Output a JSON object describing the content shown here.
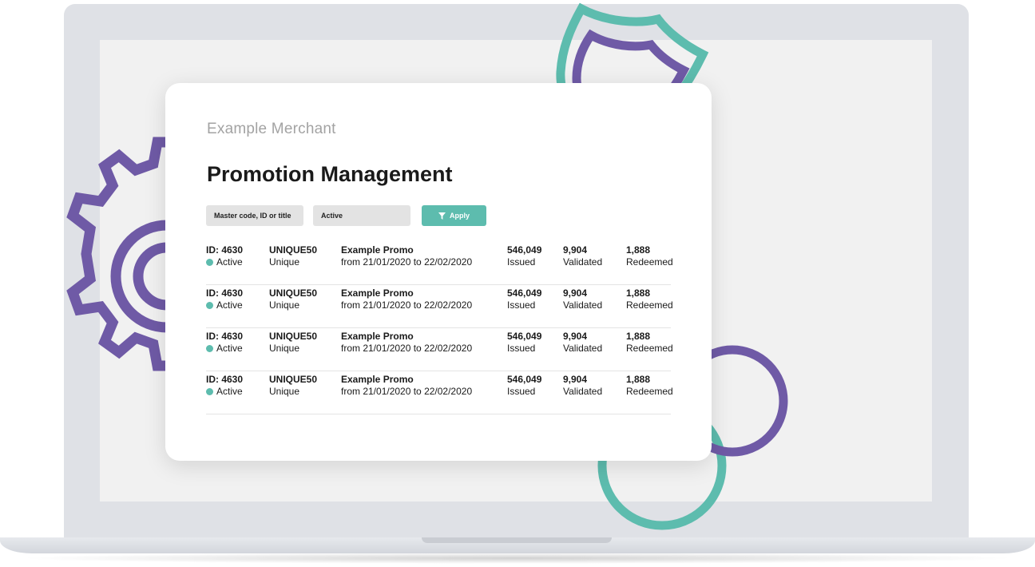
{
  "colors": {
    "accent_teal": "#5dbcae",
    "accent_purple": "#6f5aa6",
    "laptop_frame": "#dfe1e6",
    "screen_bg": "#f1f1f1"
  },
  "header": {
    "merchant": "Example Merchant",
    "title": "Promotion Management"
  },
  "filters": {
    "search_value": "Master code, ID or title",
    "status_value": "Active",
    "apply_label": "Apply",
    "apply_icon": "filter-icon"
  },
  "promotions": [
    {
      "id": "ID: 4630",
      "status": "Active",
      "code": "UNIQUE50",
      "code_type": "Unique",
      "title": "Example Promo",
      "dates": "from 21/01/2020 to 22/02/2020",
      "issued": "546,049",
      "issued_label": "Issued",
      "validated": "9,904",
      "validated_label": "Validated",
      "redeemed": "1,888",
      "redeemed_label": "Redeemed"
    },
    {
      "id": "ID: 4630",
      "status": "Active",
      "code": "UNIQUE50",
      "code_type": "Unique",
      "title": "Example Promo",
      "dates": "from 21/01/2020 to 22/02/2020",
      "issued": "546,049",
      "issued_label": "Issued",
      "validated": "9,904",
      "validated_label": "Validated",
      "redeemed": "1,888",
      "redeemed_label": "Redeemed"
    },
    {
      "id": "ID: 4630",
      "status": "Active",
      "code": "UNIQUE50",
      "code_type": "Unique",
      "title": "Example Promo",
      "dates": "from 21/01/2020 to 22/02/2020",
      "issued": "546,049",
      "issued_label": "Issued",
      "validated": "9,904",
      "validated_label": "Validated",
      "redeemed": "1,888",
      "redeemed_label": "Redeemed"
    },
    {
      "id": "ID: 4630",
      "status": "Active",
      "code": "UNIQUE50",
      "code_type": "Unique",
      "title": "Example Promo",
      "dates": "from 21/01/2020 to 22/02/2020",
      "issued": "546,049",
      "issued_label": "Issued",
      "validated": "9,904",
      "validated_label": "Validated",
      "redeemed": "1,888",
      "redeemed_label": "Redeemed"
    }
  ]
}
